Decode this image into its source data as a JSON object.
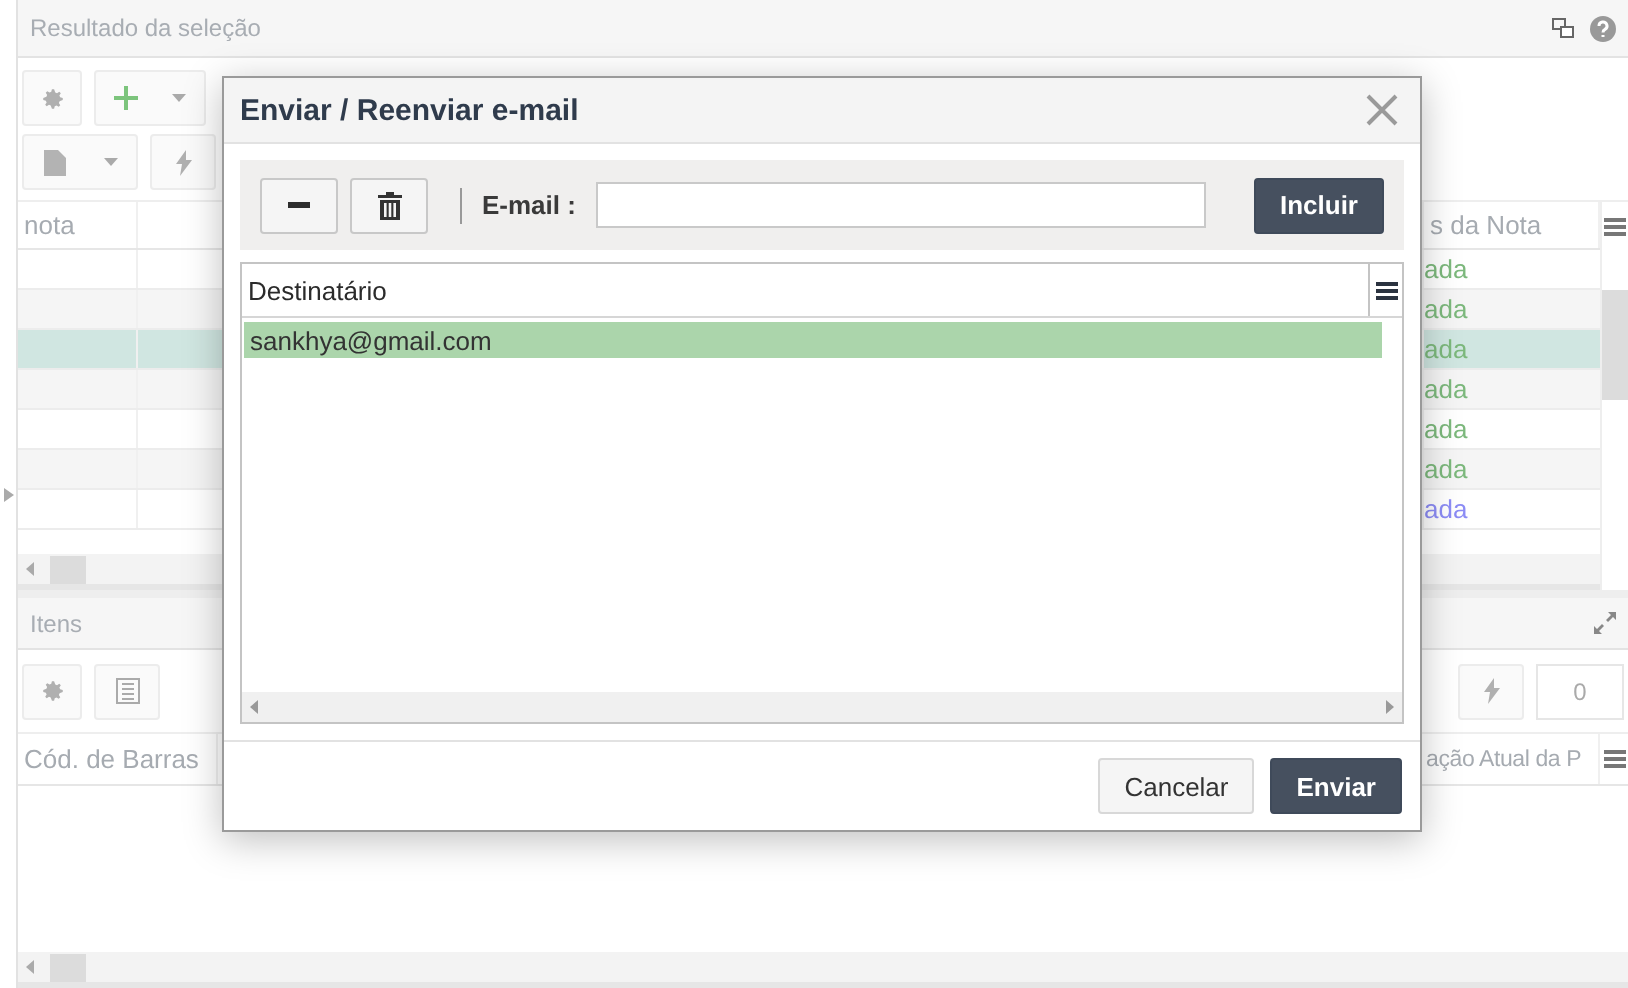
{
  "page_title": "Resultado da seleção",
  "result_grid": {
    "columns": [
      "nota",
      "s da Nota"
    ],
    "rows": [
      {
        "status": "ada",
        "color": "#7cb87c",
        "selected": false
      },
      {
        "status": "ada",
        "color": "#7cb87c",
        "selected": false
      },
      {
        "status": "ada",
        "color": "#7cb87c",
        "selected": true
      },
      {
        "status": "ada",
        "color": "#7cb87c",
        "selected": false
      },
      {
        "status": "ada",
        "color": "#7cb87c",
        "selected": false
      },
      {
        "status": "ada",
        "color": "#7cb87c",
        "selected": false
      },
      {
        "status": "ada",
        "color": "#8c8cf5",
        "selected": false
      }
    ]
  },
  "items_panel": {
    "title": "Itens",
    "counter": "0",
    "columns": [
      "Cód. de Barras",
      "ação Atual da P"
    ]
  },
  "dialog": {
    "title": "Enviar / Reenviar e-mail",
    "email_label": "E-mail :",
    "include_button": "Incluir",
    "list_header": "Destinatário",
    "recipients": [
      {
        "email": "sankhya@gmail.com",
        "selected": true
      }
    ],
    "buttons": [
      {
        "label": "Cancelar",
        "kind": "secondary"
      },
      {
        "label": "Enviar",
        "kind": "primary"
      }
    ]
  }
}
